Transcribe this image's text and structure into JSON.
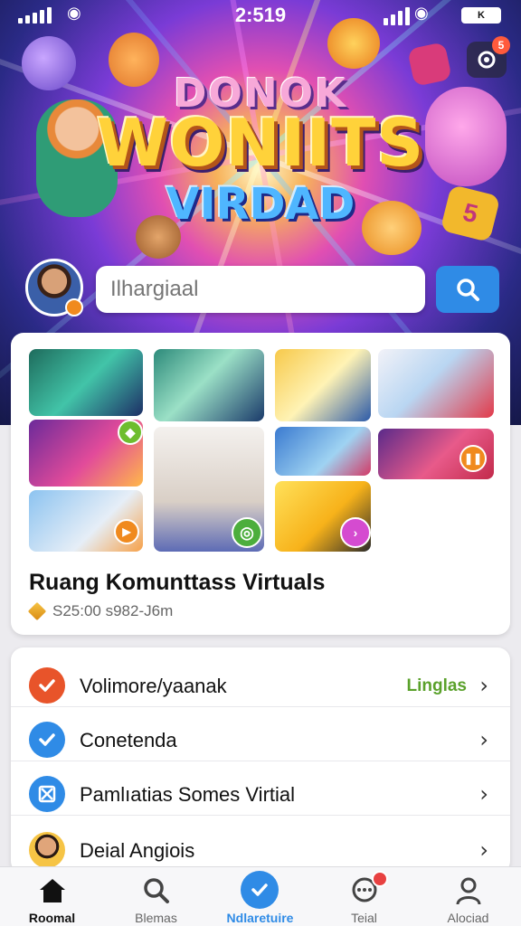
{
  "status_bar": {
    "time": "2:519",
    "battery": "K"
  },
  "hero": {
    "title_line1": "DONOK",
    "title_line2": "WONIITS",
    "title_line3": "VIRDAD",
    "notification_count": "5"
  },
  "search": {
    "placeholder": "Ilhargiaal"
  },
  "community": {
    "title": "Ruang Komunttass Virtuals",
    "meta": "S25:00 s982-J6m"
  },
  "menu": {
    "items": [
      {
        "label": "Volimore/yaanak",
        "badge": "Linglas",
        "icon": "check-icon",
        "color": "#e8542a"
      },
      {
        "label": "Conetenda",
        "icon": "check-icon",
        "color": "#2f8be6"
      },
      {
        "label": "Pamlıatias Somes Virtial",
        "icon": "box-x-icon",
        "color": "#2f8be6"
      },
      {
        "label": "Deial Angiois",
        "icon": "avatar-icon"
      }
    ]
  },
  "nav": {
    "items": [
      {
        "label": "Roomal",
        "icon": "home-icon"
      },
      {
        "label": "Blemas",
        "icon": "search-icon"
      },
      {
        "label": "Ndlaretuire",
        "icon": "check-circle-icon"
      },
      {
        "label": "Teial",
        "icon": "chat-icon"
      },
      {
        "label": "Alociad",
        "icon": "user-icon"
      }
    ],
    "active_color": "#2f8be6"
  }
}
